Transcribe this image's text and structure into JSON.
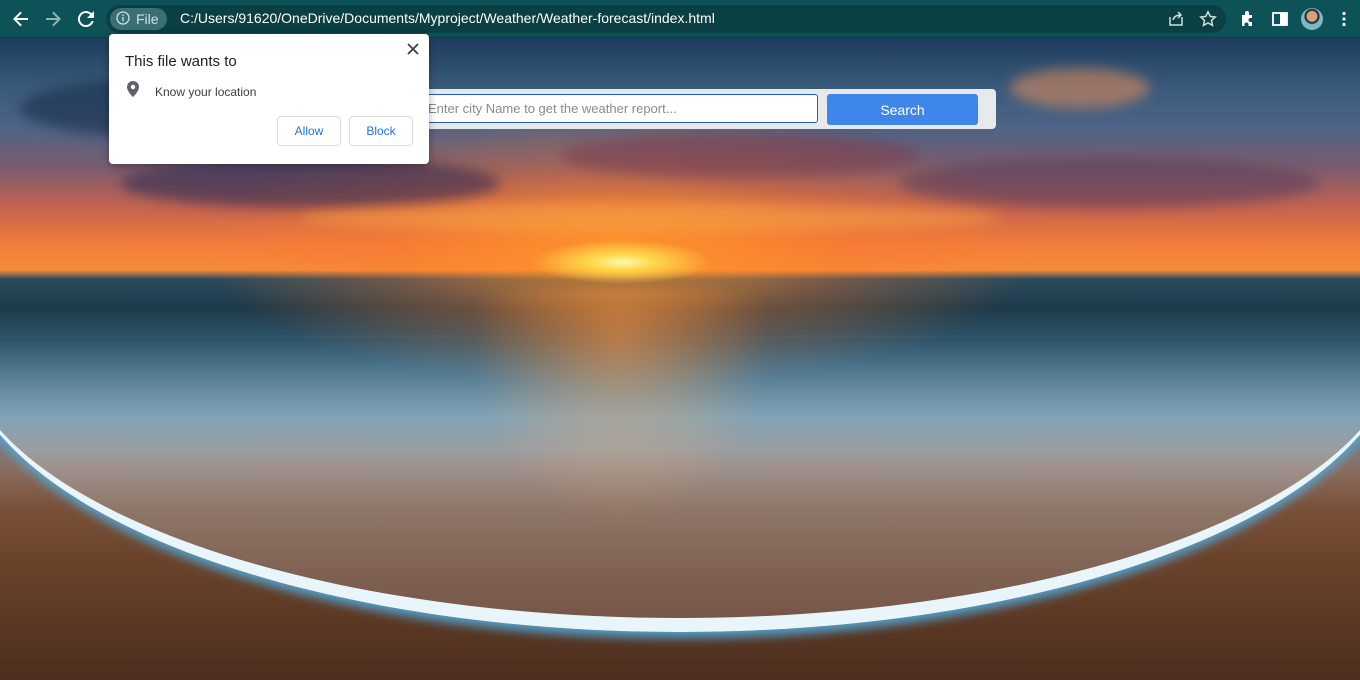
{
  "browser": {
    "site_chip_label": "File",
    "url": "C:/Users/91620/OneDrive/Documents/Myproject/Weather/Weather-forecast/index.html",
    "icons": [
      "back-icon",
      "forward-icon",
      "reload-icon",
      "info-icon",
      "share-icon",
      "star-icon",
      "extensions-icon",
      "side-panel-icon",
      "avatar",
      "menu-icon"
    ]
  },
  "permission_popup": {
    "title": "This file wants to",
    "permission": "Know your location",
    "allow_label": "Allow",
    "block_label": "Block"
  },
  "search": {
    "placeholder": "Enter city Name to get the weather report...",
    "button_label": "Search"
  },
  "colors": {
    "toolbar": "#0d5257",
    "search_button": "#3f86eb",
    "popup_button_text": "#1a73e8"
  }
}
